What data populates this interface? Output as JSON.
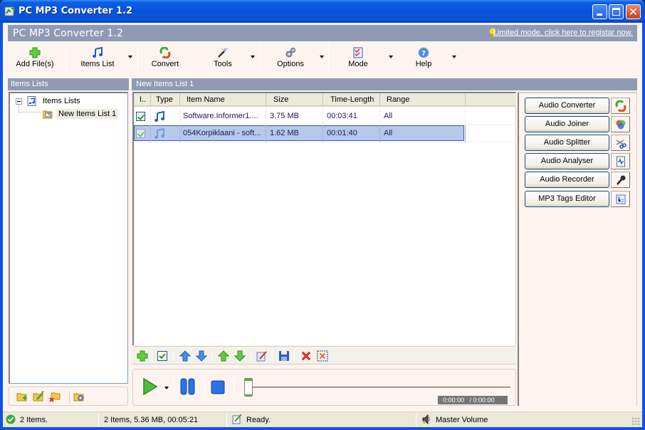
{
  "window": {
    "title": "PC MP3 Converter 1.2",
    "controls": [
      "minimize",
      "maximize",
      "close"
    ]
  },
  "banner": {
    "title": "PC MP3 Converter 1.2",
    "register_link": "Limited mode, click here to registar now."
  },
  "toolbar": {
    "buttons": [
      {
        "label": "Add File(s)",
        "icon": "add-icon",
        "has_dropdown": false
      },
      {
        "label": "Items List",
        "icon": "music-note-icon",
        "has_dropdown": true
      },
      {
        "label": "Convert",
        "icon": "convert-icon",
        "has_dropdown": false
      },
      {
        "label": "Tools",
        "icon": "magic-wand-icon",
        "has_dropdown": true
      },
      {
        "label": "Options",
        "icon": "gears-icon",
        "has_dropdown": true
      },
      {
        "label": "Mode",
        "icon": "checklist-icon",
        "has_dropdown": true
      },
      {
        "label": "Help",
        "icon": "help-icon",
        "has_dropdown": true
      }
    ]
  },
  "left_panel": {
    "header": "Items Lists",
    "tree": {
      "root": "Items Lists",
      "children": [
        "New Items List 1"
      ],
      "selected": "New Items List 1"
    },
    "bottom_icons": [
      "add-list-icon",
      "rename-list-icon",
      "delete-list-icon",
      "list-settings-icon"
    ]
  },
  "center_panel": {
    "header": "New Items List 1",
    "columns": [
      "I..",
      "Type",
      "Item Name",
      "Size",
      "Time-Length",
      "Range"
    ],
    "rows": [
      {
        "checked": true,
        "type": "audio",
        "name": "Software.Informer1....",
        "size": "3.75 MB",
        "length": "00:03:41",
        "range": "All",
        "selected": false
      },
      {
        "checked": true,
        "type": "audio",
        "name": "054Korpiklaani - soft...",
        "size": "1.62 MB",
        "length": "00:01:40",
        "range": "All",
        "selected": true
      }
    ],
    "list_toolbar_icons": [
      "add-icon",
      "check-icon",
      "move-up-icon",
      "move-down-icon",
      "move-top-icon",
      "move-bottom-icon",
      "edit-icon",
      "save-icon",
      "delete-icon",
      "delete-all-icon"
    ]
  },
  "player": {
    "time_display": "0:00:00   / 0:00:00",
    "position_fraction": 0.0
  },
  "right_panel": {
    "tools": [
      {
        "label": "Audio Converter",
        "icon": "convert-icon"
      },
      {
        "label": "Audio Joiner",
        "icon": "joiner-icon"
      },
      {
        "label": "Audio Splitter",
        "icon": "scissors-icon"
      },
      {
        "label": "Audio Analyser",
        "icon": "analyser-icon"
      },
      {
        "label": "Audio Recorder",
        "icon": "microphone-icon"
      },
      {
        "label": "MP3 Tags Editor",
        "icon": "tags-icon"
      }
    ]
  },
  "statusbar": {
    "count": "2 Items.",
    "summary": "2 Items, 5.36 MB, 00:05:21",
    "state": "Ready.",
    "volume": "Master Volume"
  },
  "colors": {
    "titlebar": "#0752d9",
    "banner": "#8f9bb5",
    "client_bg": "#fdf4ef",
    "selection": "#b7c9ea"
  }
}
